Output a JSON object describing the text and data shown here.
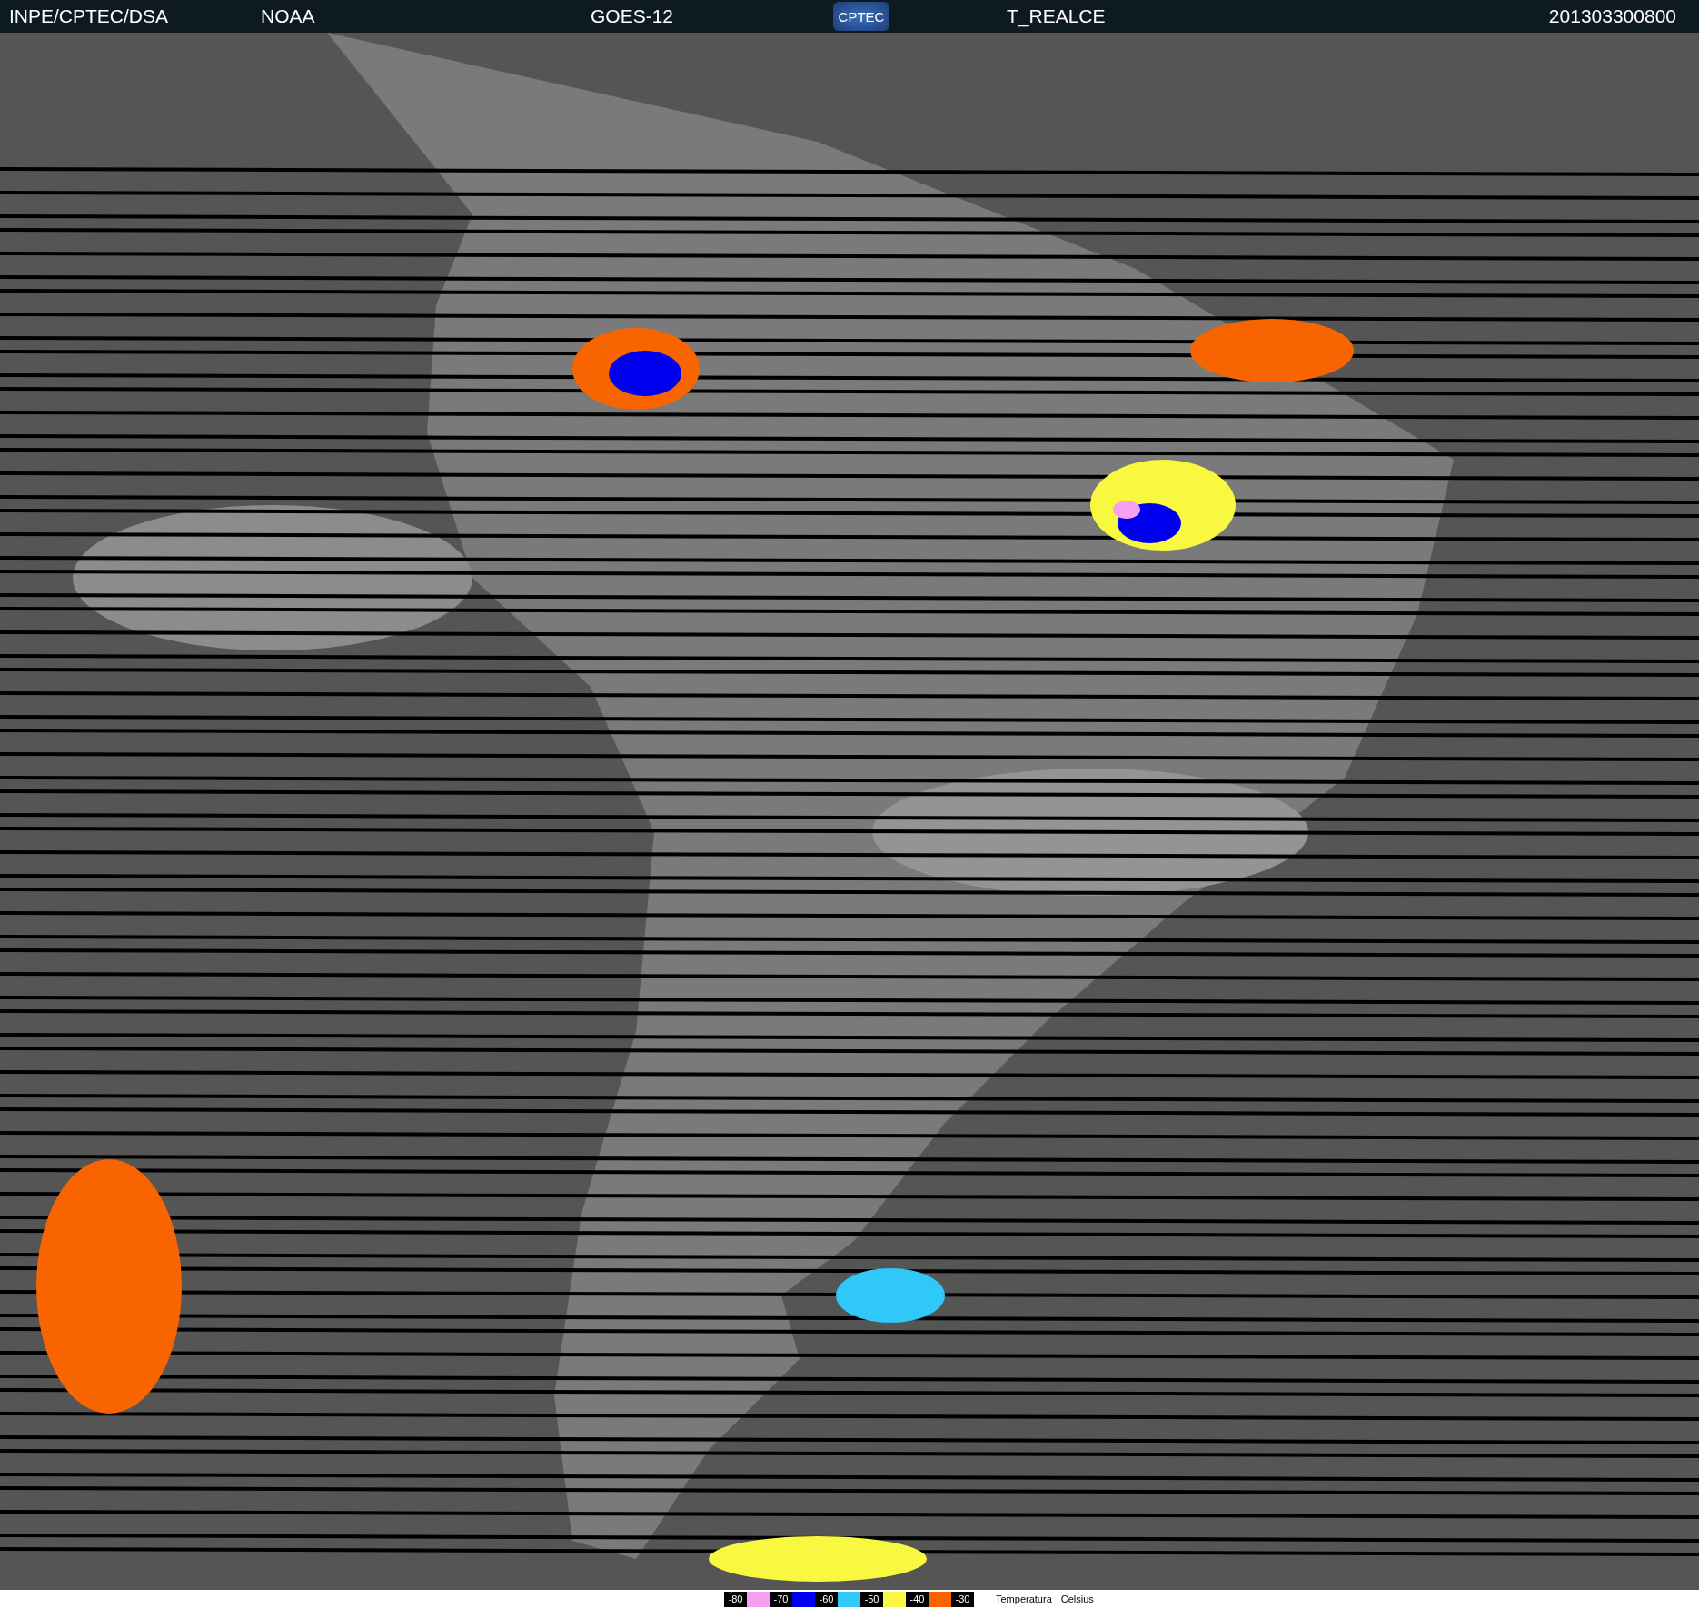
{
  "header": {
    "source": "INPE/CPTEC/DSA",
    "agency": "NOAA",
    "satellite": "GOES-12",
    "logo": "CPTEC",
    "product": "T_REALCE",
    "timestamp": "201303300800"
  },
  "legend": {
    "items": [
      {
        "kind": "label",
        "text": "-80"
      },
      {
        "kind": "swatch",
        "color": "#f5a0f0"
      },
      {
        "kind": "label",
        "text": "-70"
      },
      {
        "kind": "swatch",
        "color": "#0000f0"
      },
      {
        "kind": "label",
        "text": "-60"
      },
      {
        "kind": "swatch",
        "color": "#30c8f8"
      },
      {
        "kind": "label",
        "text": "-50"
      },
      {
        "kind": "swatch",
        "color": "#f8f840"
      },
      {
        "kind": "label",
        "text": "-40"
      },
      {
        "kind": "swatch",
        "color": "#f86400"
      },
      {
        "kind": "label",
        "text": "-30"
      }
    ],
    "quantity": "Temperatura",
    "unit": "Celsius"
  }
}
